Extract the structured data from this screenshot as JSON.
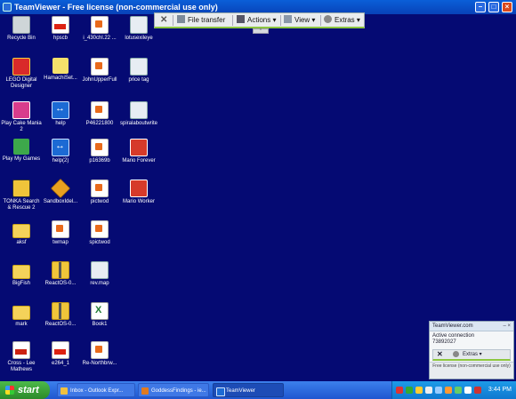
{
  "window": {
    "title": "TeamViewer - Free license (non-commercial use only)"
  },
  "toolbar": {
    "close": "✕",
    "file_transfer": "File transfer",
    "actions": "Actions ▾",
    "view": "View ▾",
    "extras": "Extras ▾",
    "handle": "⌃"
  },
  "desktop_icons": [
    {
      "label": "Recycle Bin",
      "icon": "recycle-bin-icon"
    },
    {
      "label": "hpscb",
      "icon": "pdf-icon"
    },
    {
      "label": "i_430chl.22 ...",
      "icon": "document-icon"
    },
    {
      "label": "lotusexileye",
      "icon": "image-icon"
    },
    {
      "label": "LEGO Digital Designer",
      "icon": "lego-icon"
    },
    {
      "label": "HamachiSet...",
      "icon": "hamachi-icon"
    },
    {
      "label": "JohnUpperFull",
      "icon": "document-icon"
    },
    {
      "label": "price tag",
      "icon": "image-icon"
    },
    {
      "label": "Play Cake Mania 2",
      "icon": "game-icon"
    },
    {
      "label": "help",
      "icon": "teamviewer-icon"
    },
    {
      "label": "P46221800",
      "icon": "document-icon"
    },
    {
      "label": "spiralaboutwrite",
      "icon": "image-icon"
    },
    {
      "label": "Play My Games",
      "icon": "play-icon"
    },
    {
      "label": "help(2)",
      "icon": "teamviewer-icon"
    },
    {
      "label": "p16369b",
      "icon": "document-icon"
    },
    {
      "label": "Mario Forever",
      "icon": "mario-icon"
    },
    {
      "label": "TONKA Search & Rescue 2",
      "icon": "tonka-icon"
    },
    {
      "label": "SandboxIdel...",
      "icon": "sandbox-icon"
    },
    {
      "label": "pictwod",
      "icon": "document-icon"
    },
    {
      "label": "Mario Worker",
      "icon": "mario-icon"
    },
    {
      "label": "aksf",
      "icon": "folder-icon"
    },
    {
      "label": "twmap",
      "icon": "document-icon"
    },
    {
      "label": "spictwod",
      "icon": "document-icon"
    },
    {
      "label": "BigFish",
      "icon": "folder-icon"
    },
    {
      "label": "ReactOS-0...",
      "icon": "zip-icon"
    },
    {
      "label": "rev.map",
      "icon": "map-icon"
    },
    {
      "label": "mark",
      "icon": "folder-icon"
    },
    {
      "label": "ReactOS-0...",
      "icon": "zip-icon"
    },
    {
      "label": "Book1",
      "icon": "excel-icon"
    },
    {
      "label": "Cross - Lee Mathews",
      "icon": "pdf-icon"
    },
    {
      "label": "e264_1",
      "icon": "document-icon"
    },
    {
      "label": "Re-Northbrw...",
      "icon": "document-icon"
    }
  ],
  "panel": {
    "title": "TeamViewer.com",
    "controls": "– ×",
    "status": "Active connection",
    "id": "73892027",
    "extras": "Extras ▾",
    "footer": "Free license (non-commercial use only)"
  },
  "taskbar": {
    "start": "start",
    "tasks": [
      {
        "label": "Inbox - Outlook Expr...",
        "color": "#f0c040"
      },
      {
        "label": "GoddessFindings - ie...",
        "color": "#e07a20"
      },
      {
        "label": "TeamViewer",
        "color": "#1c6ad4"
      }
    ],
    "clock": "3:44 PM"
  }
}
